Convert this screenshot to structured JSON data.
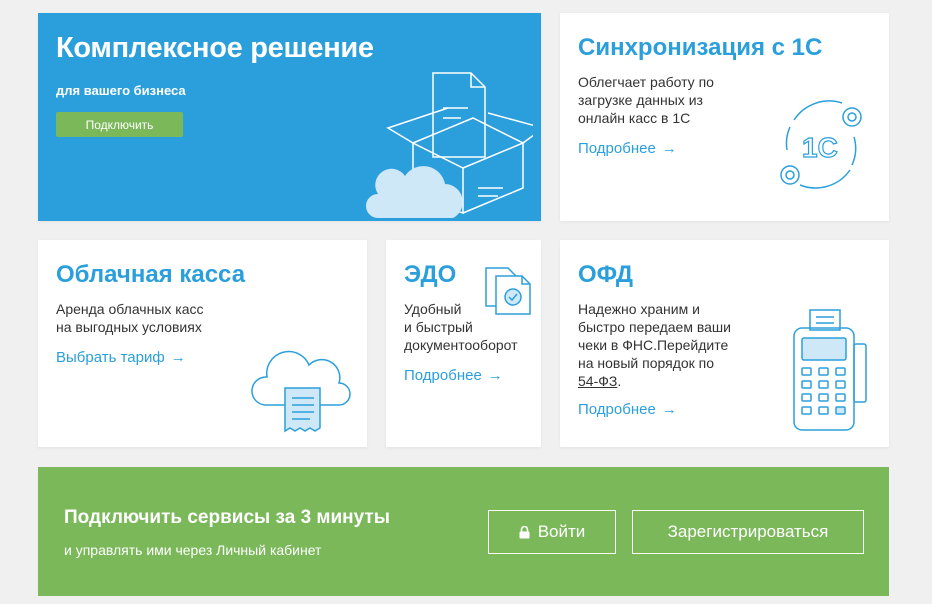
{
  "hero": {
    "title": "Комплексное решение",
    "subtitle": "для вашего бизнеса",
    "button": "Подключить"
  },
  "sync": {
    "title": "Синхронизация с 1С",
    "text_lines": [
      "Облегчает работу по",
      "загрузке данных из",
      "онлайн касс в 1С"
    ],
    "link": "Подробнее",
    "badge": "1C"
  },
  "cloud": {
    "title": "Облачная касса",
    "text_lines": [
      "Аренда облачных касс",
      "на выгодных условиях"
    ],
    "link": "Выбрать тариф"
  },
  "edo": {
    "title": "ЭДО",
    "text_lines": [
      "Удобный",
      "и быстрый",
      "документооборот"
    ],
    "link": "Подробнее"
  },
  "ofd": {
    "title": "ОФД",
    "text_lines": [
      "Надежно храним и",
      "быстро передаем ваши",
      "чеки в ФНС.Перейдите",
      "на новый порядок по"
    ],
    "law_link": "54-ФЗ",
    "law_suffix": ".",
    "link": "Подробнее"
  },
  "bottom": {
    "title": "Подключить сервисы за 3 минуты",
    "subtitle": "и управлять ими через Личный кабинет",
    "login": "Войти",
    "register": "Зарегистрироваться"
  },
  "colors": {
    "blue": "#2b9fdc",
    "green": "#7ab85a",
    "background": "#f0f0f0"
  },
  "icons": [
    "box-cloud-illustration",
    "sync-1c-icon",
    "cloud-receipt-icon",
    "document-check-icon",
    "pos-terminal-icon",
    "arrow-right-icon",
    "lock-icon"
  ]
}
